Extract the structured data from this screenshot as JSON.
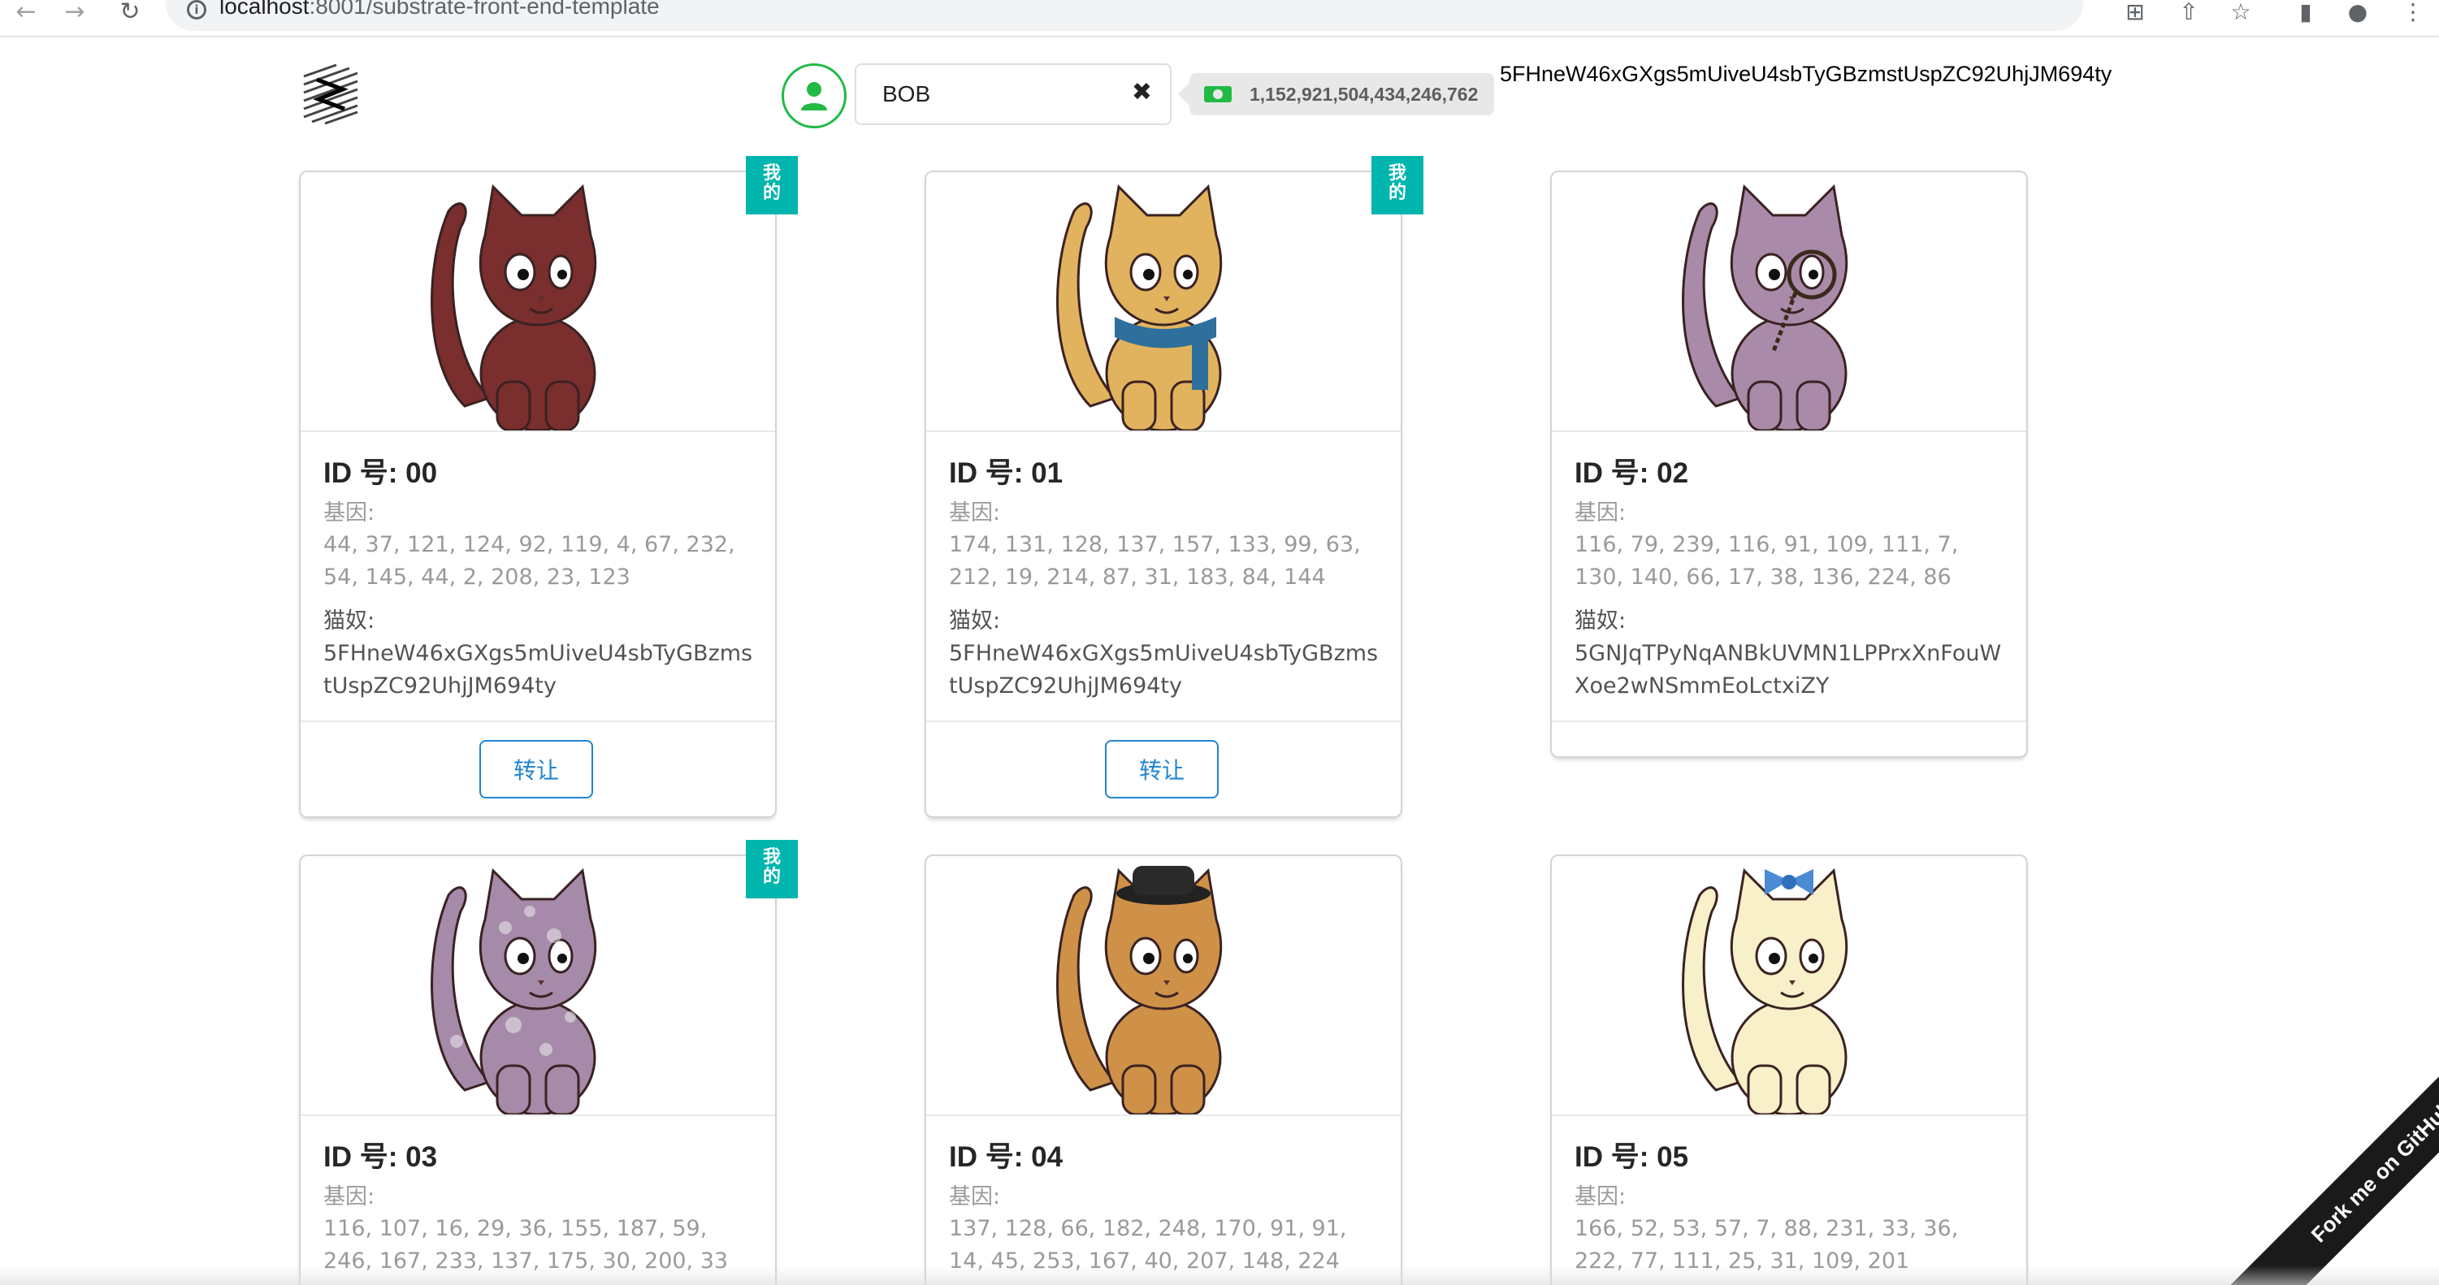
{
  "browser": {
    "url_host": "localhost",
    "url_path": ":8001/substrate-front-end-template"
  },
  "header": {
    "account_name": "BOB",
    "balance": "1,152,921,504,434,246,762",
    "address": "5FHneW46xGXgs5mUiveU4sbTyGBzmstUspZC92UhjJM694ty"
  },
  "labels": {
    "mine_ribbon_line1": "我",
    "mine_ribbon_line2": "的",
    "genes_label": "基因:",
    "owner_label": "猫奴:",
    "transfer_button": "转让",
    "github_ribbon": "Fork me on GitHub"
  },
  "kitties": [
    {
      "id_label": "ID 号: 00",
      "genes": "44, 37, 121, 124, 92, 119, 4, 67, 232, 54, 145, 44, 2, 208, 23, 123",
      "owner": "5FHneW46xGXgs5mUiveU4sbTyGBzmstUspZC92UhjJM694ty",
      "mine": true,
      "color": "#7a2e2e"
    },
    {
      "id_label": "ID 号: 01",
      "genes": "174, 131, 128, 137, 157, 133, 99, 63, 212, 19, 214, 87, 31, 183, 84, 144",
      "owner": "5FHneW46xGXgs5mUiveU4sbTyGBzmstUspZC92UhjJM694ty",
      "mine": true,
      "color": "#e2b35e"
    },
    {
      "id_label": "ID 号: 02",
      "genes": "116, 79, 239, 116, 91, 109, 111, 7, 130, 140, 66, 17, 38, 136, 224, 86",
      "owner": "5GNJqTPyNqANBkUVMN1LPPrxXnFouWXoe2wNSmmEoLctxiZY",
      "mine": false,
      "color": "#a98aa8"
    },
    {
      "id_label": "ID 号: 03",
      "genes": "116, 107, 16, 29, 36, 155, 187, 59, 246, 167, 233, 137, 175, 30, 200, 33",
      "mine": true,
      "color": "#a58aaa"
    },
    {
      "id_label": "ID 号: 04",
      "genes": "137, 128, 66, 182, 248, 170, 91, 91, 14, 45, 253, 167, 40, 207, 148, 224",
      "mine": false,
      "color": "#cf9147"
    },
    {
      "id_label": "ID 号: 05",
      "genes": "166, 52, 53, 57, 7, 88, 231, 33, 36, 222, 77, 111, 25, 31, 109, 201",
      "mine": false,
      "color": "#f8f0c8"
    }
  ]
}
